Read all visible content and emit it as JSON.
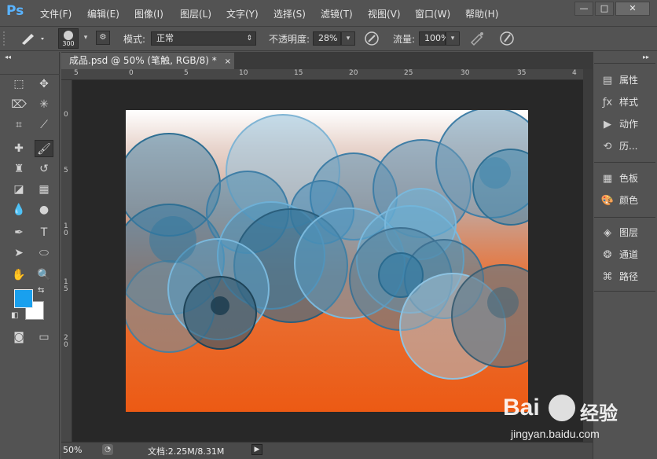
{
  "app": {
    "logo": "Ps"
  },
  "menu": [
    "文件(F)",
    "编辑(E)",
    "图像(I)",
    "图层(L)",
    "文字(Y)",
    "选择(S)",
    "滤镜(T)",
    "视图(V)",
    "窗口(W)",
    "帮助(H)"
  ],
  "window_controls": {
    "minimize": "—",
    "restore": "□",
    "close": "✕"
  },
  "options": {
    "brush_size": "300",
    "mode_label": "模式:",
    "mode_value": "正常",
    "opacity_label": "不透明度:",
    "opacity_value": "28%",
    "flow_label": "流量:",
    "flow_value": "100%"
  },
  "document": {
    "tab_title": "成品.psd @ 50% (笔触, RGB/8) *",
    "close": "×",
    "ruler_top": [
      "5",
      "0",
      "5",
      "10",
      "15",
      "20",
      "25",
      "30",
      "35",
      "4"
    ],
    "ruler_left": [
      "0",
      "5",
      "1\n0",
      "1\n5",
      "2\n0"
    ]
  },
  "status": {
    "zoom": "50%",
    "doc_info": "文档:2.25M/8.31M"
  },
  "right_panel": {
    "group1": [
      "属性",
      "样式",
      "动作",
      "历..."
    ],
    "group2": [
      "色板",
      "颜色"
    ],
    "group3": [
      "图层",
      "通道",
      "路径"
    ]
  },
  "colors": {
    "foreground": "#19a0ee",
    "background": "#ffffff",
    "canvas_orange": "#ec5f1a",
    "circle_blue": "#2f7ea6"
  },
  "watermark": {
    "brand": "Bai",
    "brand2": "经验",
    "url": "jingyan.baidu.com"
  }
}
